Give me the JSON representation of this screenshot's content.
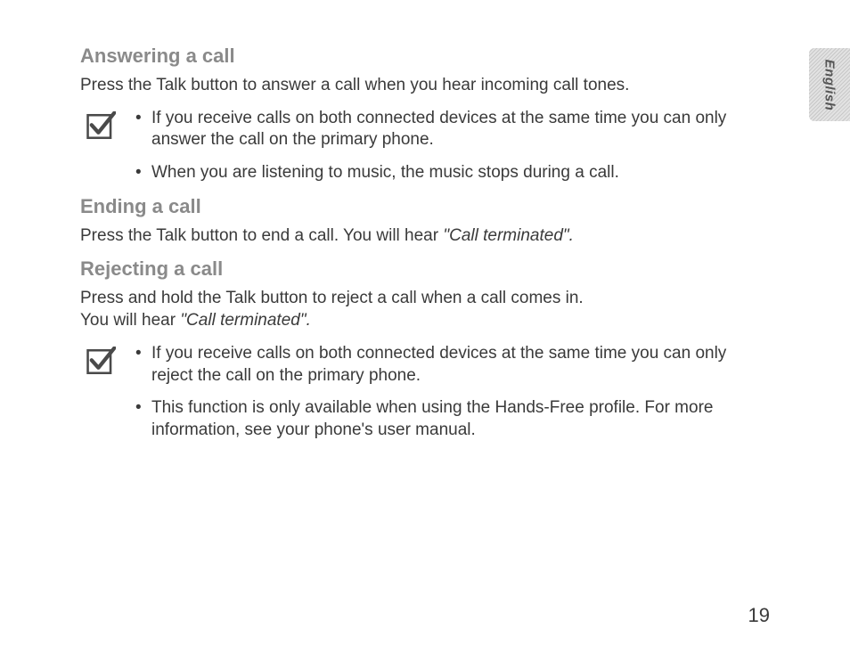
{
  "language_tab": "English",
  "sections": {
    "answering": {
      "heading": "Answering a call",
      "body": "Press the Talk button to answer a call when you hear incoming call tones.",
      "notes": [
        "If you receive calls on both connected devices at the same time you can only answer the call on the primary phone.",
        "When you are listening to music, the music stops during a call."
      ]
    },
    "ending": {
      "heading": "Ending a call",
      "body_prefix": "Press the Talk button to end a call. You will hear ",
      "body_italic": "\"Call terminated\"."
    },
    "rejecting": {
      "heading": "Rejecting a call",
      "body_line1": "Press and hold the Talk button to reject a call when a call comes in.",
      "body_line2_prefix": "You will hear ",
      "body_line2_italic": "\"Call terminated\".",
      "notes": [
        "If you receive calls on both connected devices at the same time you can only reject the call on the primary phone.",
        "This function is only available when using the Hands-Free profile. For more information, see your phone's user manual."
      ]
    }
  },
  "page_number": "19"
}
